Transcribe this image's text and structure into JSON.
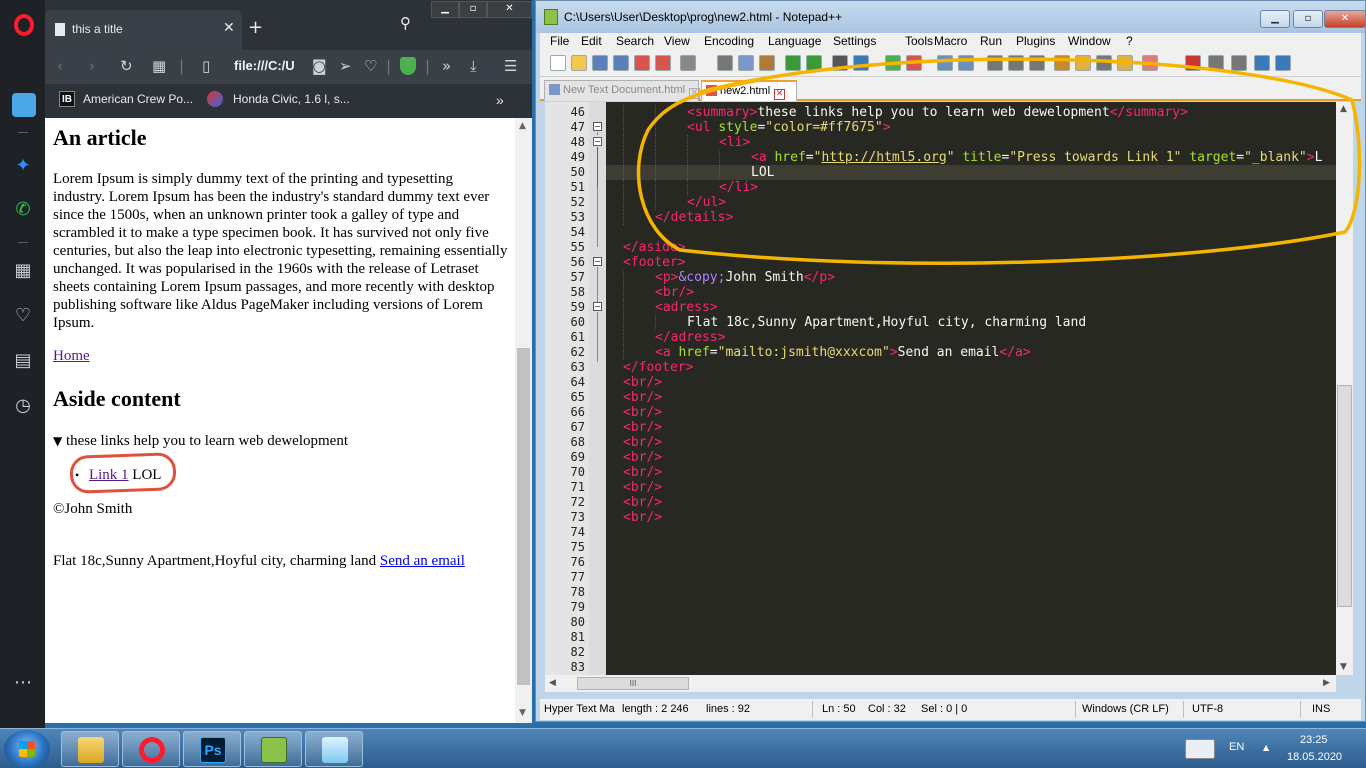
{
  "opera": {
    "tab_title": "this a title",
    "address": "file:///C:/U",
    "bookmarks": [
      {
        "label": "American Crew Po..."
      },
      {
        "label": "Honda Civic, 1.6 l, s..."
      }
    ],
    "bookmark1_badge": "IB",
    "page": {
      "article_heading": "An article",
      "article_text": "Lorem Ipsum is simply dummy text of the printing and typesetting industry. Lorem Ipsum has been the industry's standard dummy text ever since the 1500s, when an unknown printer took a galley of type and scrambled it to make a type specimen book. It has survived not only five centuries, but also the leap into electronic typesetting, remaining essentially unchanged. It was popularised in the 1960s with the release of Letraset sheets containing Lorem Ipsum passages, and more recently with desktop publishing software like Aldus PageMaker including versions of Lorem Ipsum.",
      "home_link": "Home",
      "aside_heading": "Aside content",
      "summary": "these links help you to learn web dewelopment",
      "link1": "Link 1",
      "link1_suffix": " LOL",
      "copyright": "©John Smith",
      "address": "Flat 18c,Sunny Apartment,Hoyful city, charming land",
      "email_link": "Send an email"
    }
  },
  "npp": {
    "title": "C:\\Users\\User\\Desktop\\prog\\new2.html - Notepad++",
    "menu": [
      "File",
      "Edit",
      "Search",
      "View",
      "Encoding",
      "Language",
      "Settings",
      "Tools",
      "Macro",
      "Run",
      "Plugins",
      "Window",
      "?"
    ],
    "tabs": [
      {
        "label": "New Text Document.html",
        "active": false
      },
      {
        "label": "new2.html",
        "active": true
      }
    ],
    "lines": [
      {
        "n": "46",
        "indent": 2,
        "code": [
          [
            "tag",
            "<summary>"
          ],
          [
            "txt",
            "these links help you to learn web dewelopment"
          ],
          [
            "tag",
            "</summary>"
          ]
        ]
      },
      {
        "n": "47",
        "indent": 2,
        "code": [
          [
            "tag",
            "<ul "
          ],
          [
            "att",
            "style"
          ],
          [
            "txt",
            "="
          ],
          [
            "val",
            "\"color=#ff7675\""
          ],
          [
            "tag",
            ">"
          ]
        ]
      },
      {
        "n": "48",
        "indent": 3,
        "code": [
          [
            "tag",
            "<li>"
          ]
        ]
      },
      {
        "n": "49",
        "indent": 4,
        "code": [
          [
            "tag",
            "<a "
          ],
          [
            "att",
            "href"
          ],
          [
            "txt",
            "="
          ],
          [
            "val",
            "\""
          ],
          [
            "valu",
            "http://html5.org"
          ],
          [
            "val",
            "\""
          ],
          [
            "txt",
            " "
          ],
          [
            "att",
            "title"
          ],
          [
            "txt",
            "="
          ],
          [
            "val",
            "\"Press towards Link 1\""
          ],
          [
            "txt",
            " "
          ],
          [
            "att",
            "target"
          ],
          [
            "txt",
            "="
          ],
          [
            "val",
            "\"_blank\""
          ],
          [
            "tag",
            ">"
          ],
          [
            "txt",
            "L"
          ]
        ]
      },
      {
        "n": "50",
        "indent": 4,
        "code": [
          [
            "txt",
            "LOL"
          ]
        ]
      },
      {
        "n": "51",
        "indent": 3,
        "code": [
          [
            "tag",
            "</li>"
          ]
        ]
      },
      {
        "n": "52",
        "indent": 2,
        "code": [
          [
            "tag",
            "</ul>"
          ]
        ]
      },
      {
        "n": "53",
        "indent": 1,
        "code": [
          [
            "tag",
            "</details>"
          ]
        ]
      },
      {
        "n": "54",
        "indent": 0,
        "code": []
      },
      {
        "n": "55",
        "indent": 0,
        "code": [
          [
            "tag",
            "</aside>"
          ]
        ]
      },
      {
        "n": "56",
        "indent": 0,
        "code": [
          [
            "tag",
            "<footer>"
          ]
        ]
      },
      {
        "n": "57",
        "indent": 1,
        "code": [
          [
            "tag",
            "<p>"
          ],
          [
            "ent",
            "&copy;"
          ],
          [
            "txt",
            "John Smith"
          ],
          [
            "tag",
            "</p>"
          ]
        ]
      },
      {
        "n": "58",
        "indent": 1,
        "code": [
          [
            "tag",
            "<br/>"
          ]
        ]
      },
      {
        "n": "59",
        "indent": 1,
        "code": [
          [
            "tag",
            "<adress>"
          ]
        ]
      },
      {
        "n": "60",
        "indent": 2,
        "code": [
          [
            "txt",
            "Flat 18c,Sunny Apartment,Hoyful city, charming land"
          ]
        ]
      },
      {
        "n": "61",
        "indent": 1,
        "code": [
          [
            "tag",
            "</adress>"
          ]
        ]
      },
      {
        "n": "62",
        "indent": 1,
        "code": [
          [
            "tag",
            "<a "
          ],
          [
            "att",
            "href"
          ],
          [
            "txt",
            "="
          ],
          [
            "val",
            "\"mailto:jsmith@xxxcom\""
          ],
          [
            "tag",
            ">"
          ],
          [
            "txt",
            "Send an email"
          ],
          [
            "tag",
            "</a>"
          ]
        ]
      },
      {
        "n": "63",
        "indent": 0,
        "code": [
          [
            "tag",
            "</footer>"
          ]
        ]
      },
      {
        "n": "64",
        "indent": 0,
        "code": [
          [
            "tag",
            "<br/>"
          ]
        ]
      },
      {
        "n": "65",
        "indent": 0,
        "code": [
          [
            "tag",
            "<br/>"
          ]
        ]
      },
      {
        "n": "66",
        "indent": 0,
        "code": [
          [
            "tag",
            "<br/>"
          ]
        ]
      },
      {
        "n": "67",
        "indent": 0,
        "code": [
          [
            "tag",
            "<br/>"
          ]
        ]
      },
      {
        "n": "68",
        "indent": 0,
        "code": [
          [
            "tag",
            "<br/>"
          ]
        ]
      },
      {
        "n": "69",
        "indent": 0,
        "code": [
          [
            "tag",
            "<br/>"
          ]
        ]
      },
      {
        "n": "70",
        "indent": 0,
        "code": [
          [
            "tag",
            "<br/>"
          ]
        ]
      },
      {
        "n": "71",
        "indent": 0,
        "code": [
          [
            "tag",
            "<br/>"
          ]
        ]
      },
      {
        "n": "72",
        "indent": 0,
        "code": [
          [
            "tag",
            "<br/>"
          ]
        ]
      },
      {
        "n": "73",
        "indent": 0,
        "code": [
          [
            "tag",
            "<br/>"
          ]
        ]
      },
      {
        "n": "74",
        "indent": 0,
        "code": []
      },
      {
        "n": "75",
        "indent": 0,
        "code": []
      },
      {
        "n": "76",
        "indent": 0,
        "code": []
      },
      {
        "n": "77",
        "indent": 0,
        "code": []
      },
      {
        "n": "78",
        "indent": 0,
        "code": []
      },
      {
        "n": "79",
        "indent": 0,
        "code": []
      },
      {
        "n": "80",
        "indent": 0,
        "code": []
      },
      {
        "n": "81",
        "indent": 0,
        "code": []
      },
      {
        "n": "82",
        "indent": 0,
        "code": []
      },
      {
        "n": "83",
        "indent": 0,
        "code": []
      }
    ],
    "status": {
      "type": "Hyper Text Ma",
      "length": "length : 2 246",
      "lines": "lines : 92",
      "ln": "Ln : 50",
      "col": "Col : 32",
      "sel": "Sel : 0 | 0",
      "eol": "Windows (CR LF)",
      "encoding": "UTF-8",
      "mode": "INS"
    },
    "hscroll_grip": "III"
  },
  "taskbar": {
    "lang": "EN",
    "time": "23:25",
    "date": "18.05.2020",
    "ps_label": "Ps"
  },
  "colors": {
    "annotation_yellow": "#f4b400",
    "annotation_red": "#e0503a",
    "editor_bg": "#272822"
  }
}
